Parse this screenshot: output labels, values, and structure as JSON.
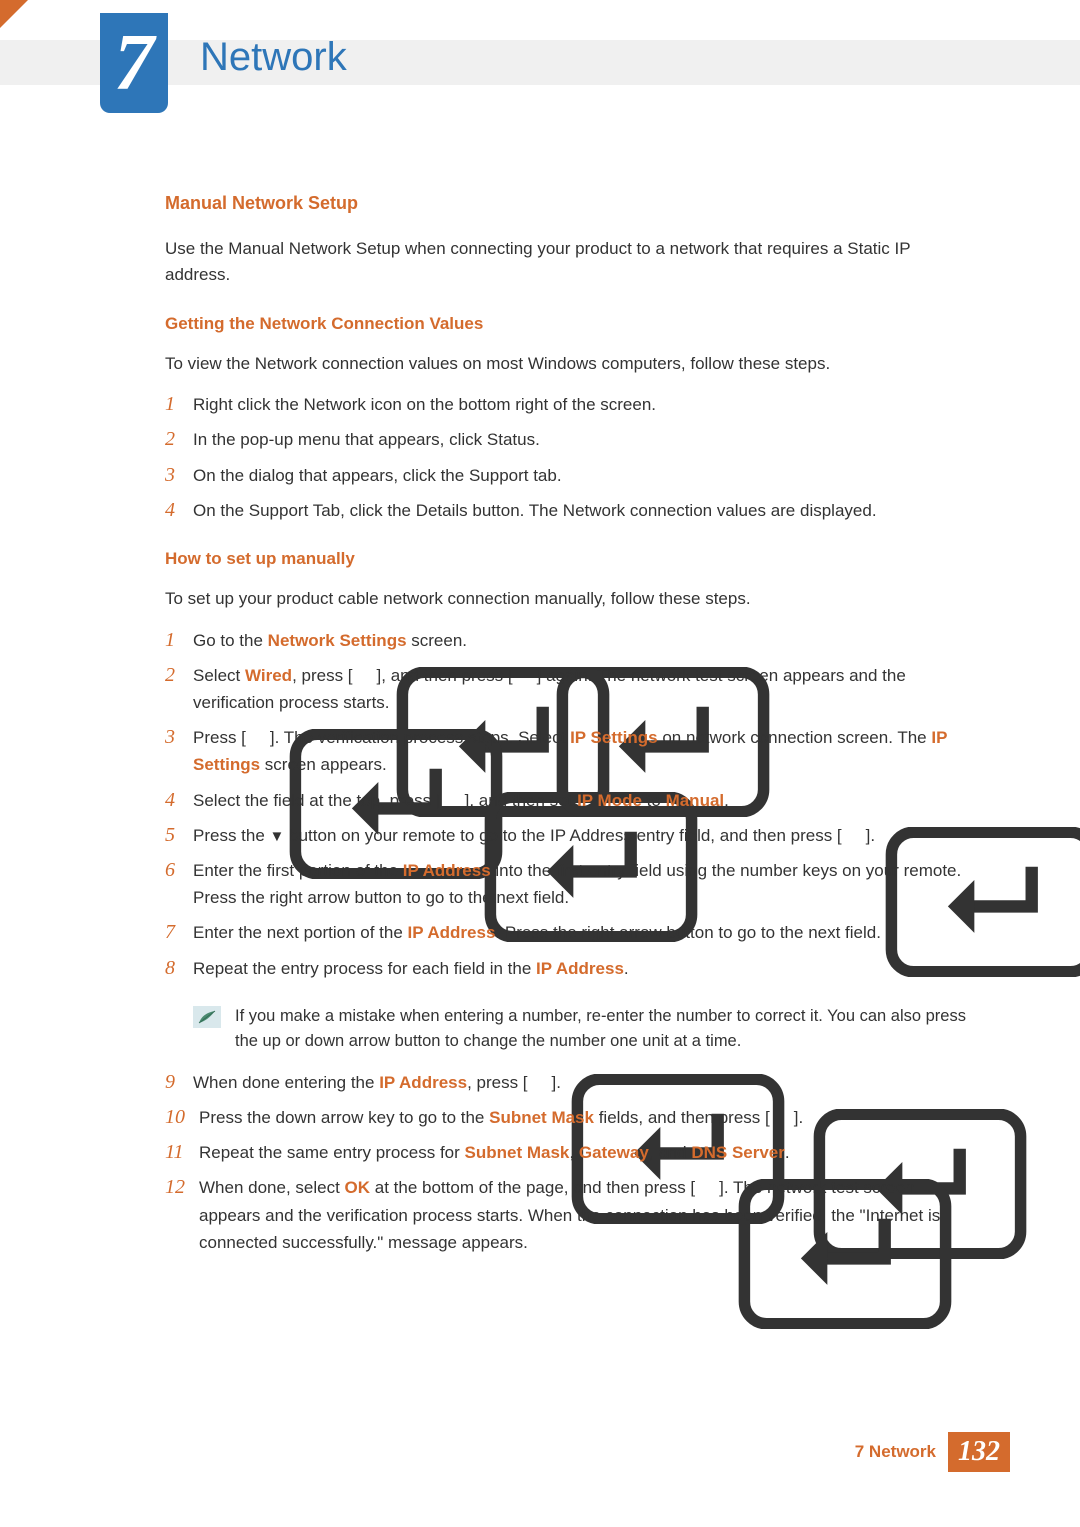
{
  "header": {
    "chapter_number": "7",
    "chapter_title": "Network"
  },
  "section": {
    "heading": "Manual Network Setup",
    "intro": "Use the Manual Network Setup when connecting your product to a network that requires a Static IP address.",
    "sub1": {
      "heading": "Getting the Network Connection Values",
      "intro": "To view the Network connection values on most Windows computers, follow these steps.",
      "steps": {
        "s1": "Right click the Network icon on the bottom right of the screen.",
        "s2": "In the pop-up menu that appears, click Status.",
        "s3": "On the dialog that appears, click the Support tab.",
        "s4": "On the Support Tab, click the Details button. The Network connection values are displayed."
      }
    },
    "sub2": {
      "heading": "How to set up manually",
      "intro": "To set up your product cable network connection manually, follow these steps.",
      "steps": {
        "s1_a": "Go to the ",
        "s1_hl": "Network Settings",
        "s1_b": " screen.",
        "s2_a": "Select ",
        "s2_hl": "Wired",
        "s2_b": ", press [",
        "s2_c": "], and then press [",
        "s2_d": "] again. The network test screen appears and the verification process starts.",
        "s3_a": "Press [",
        "s3_b": "]. The verification process stops. Select ",
        "s3_hl1": "IP Settings",
        "s3_c": " on network connection screen. The ",
        "s3_hl2": "IP Settings",
        "s3_d": " screen appears.",
        "s4_a": "Select the field at the top, press [",
        "s4_b": "], and then set ",
        "s4_hl1": "IP Mode",
        "s4_c": " to ",
        "s4_hl2": "Manual",
        "s4_d": ".",
        "s5_a": "Press the ",
        "s5_sym": "▼",
        "s5_b": " button on your remote to go to the IP Address entry field, and then press [",
        "s5_c": "].",
        "s6_a": "Enter the first portion of the ",
        "s6_hl": "IP Address",
        "s6_b": " into the first entry field using the number keys on your remote. Press the right arrow button to go to the next field.",
        "s7_a": "Enter the next portion of the ",
        "s7_hl": "IP Address",
        "s7_b": ". Press the right arrow button to go to the next field.",
        "s8_a": "Repeat the entry process for each field in the ",
        "s8_hl": "IP Address",
        "s8_b": ".",
        "note": "If you make a mistake when entering a number, re-enter the number to correct it. You can also press the up or down arrow button to change the number one unit at a time.",
        "s9_a": "When done entering the ",
        "s9_hl": "IP Address",
        "s9_b": ", press [",
        "s9_c": "].",
        "s10_a": "Press the down arrow key to go to the ",
        "s10_hl": "Subnet Mask",
        "s10_b": " fields, and then press [",
        "s10_c": "].",
        "s11_a": "Repeat the same entry process for ",
        "s11_hl1": "Subnet Mask",
        "s11_b": ", ",
        "s11_hl2": "Gateway",
        "s11_c": ", and ",
        "s11_hl3": "DNS Server",
        "s11_d": ".",
        "s12_a": "When done, select ",
        "s12_hl": "OK",
        "s12_b": " at the bottom of the page, and then press [",
        "s12_c": "]. The network test screen appears and the verification process starts. When the connection has been verified, the \"Internet is connected successfully.\" message appears."
      }
    }
  },
  "footer": {
    "chapter_label": "7 Network",
    "page_number": "132"
  },
  "nums": {
    "n1": "1",
    "n2": "2",
    "n3": "3",
    "n4": "4",
    "n5": "5",
    "n6": "6",
    "n7": "7",
    "n8": "8",
    "n9": "9",
    "n10": "10",
    "n11": "11",
    "n12": "12"
  }
}
